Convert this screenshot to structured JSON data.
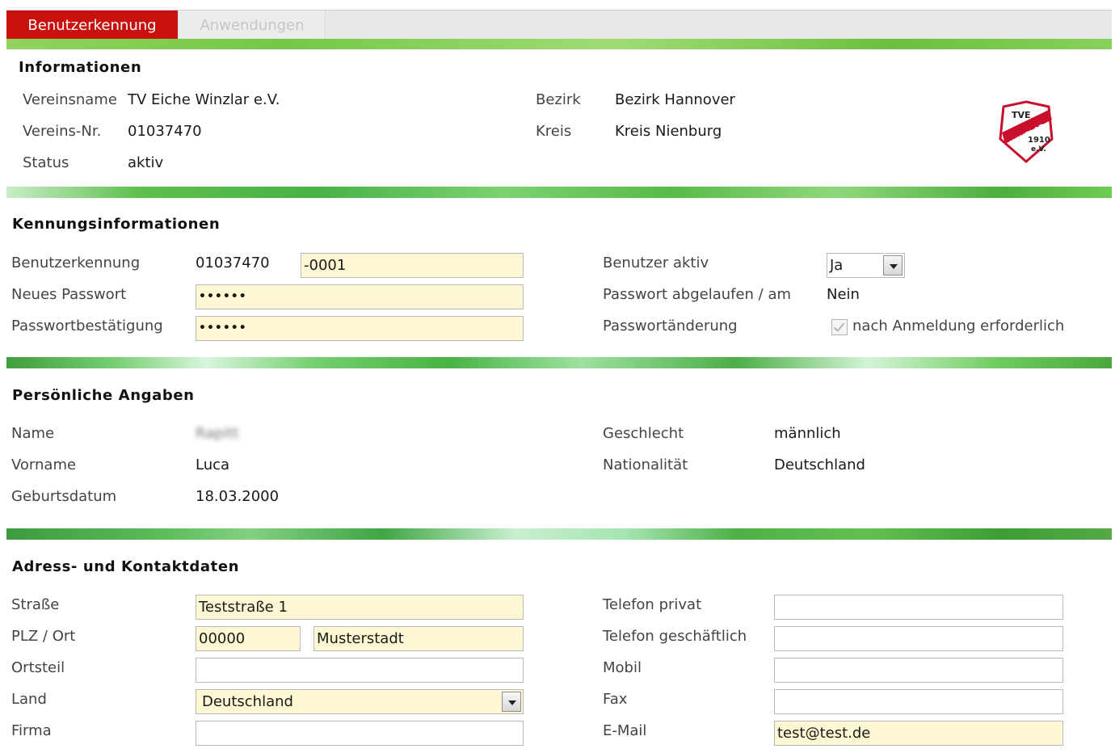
{
  "tabs": [
    {
      "label": "Benutzerkennung",
      "active": true
    },
    {
      "label": "Anwendungen",
      "active": false
    }
  ],
  "informationen": {
    "heading": "Informationen",
    "vereinsname": {
      "label": "Vereinsname",
      "value": "TV Eiche Winzlar e.V."
    },
    "vereinsnr": {
      "label": "Vereins-Nr.",
      "value": "01037470"
    },
    "status": {
      "label": "Status",
      "value": "aktiv"
    },
    "bezirk": {
      "label": "Bezirk",
      "value": "Bezirk Hannover"
    },
    "kreis": {
      "label": "Kreis",
      "value": "Kreis Nienburg"
    },
    "logo": {
      "icon": "club-logo-icon",
      "line1": "TVE",
      "line2": "WINZLAR",
      "line3": "1910",
      "line4": "e.V.",
      "color": "#c8102e"
    }
  },
  "kennung": {
    "heading": "Kennungsinformationen",
    "benutzerkennung": {
      "label": "Benutzerkennung",
      "prefix": "01037470",
      "suffix": "-0001"
    },
    "passwort": {
      "label": "Neues Passwort",
      "value": "••••••"
    },
    "bestaetigung": {
      "label": "Passwortbestätigung",
      "value": "••••••"
    },
    "aktiv": {
      "label": "Benutzer aktiv",
      "value": "Ja"
    },
    "abgelaufen": {
      "label": "Passwort abgelaufen / am",
      "value": "Nein"
    },
    "aenderung": {
      "label": "Passwortänderung",
      "checkbox_label": "nach Anmeldung erforderlich",
      "checked": true
    }
  },
  "persoenlich": {
    "heading": "Persönliche Angaben",
    "name": {
      "label": "Name",
      "value": "Rapitt"
    },
    "vorname": {
      "label": "Vorname",
      "value": "Luca"
    },
    "geburtsdatum": {
      "label": "Geburtsdatum",
      "value": "18.03.2000"
    },
    "geschlecht": {
      "label": "Geschlecht",
      "value": "männlich"
    },
    "nationalitaet": {
      "label": "Nationalität",
      "value": "Deutschland"
    }
  },
  "adresse": {
    "heading": "Adress- und Kontaktdaten",
    "strasse": {
      "label": "Straße",
      "value": "Teststraße 1"
    },
    "plzort": {
      "label": "PLZ / Ort",
      "plz": "00000",
      "ort": "Musterstadt"
    },
    "ortsteil": {
      "label": "Ortsteil",
      "value": ""
    },
    "land": {
      "label": "Land",
      "value": "Deutschland"
    },
    "firma": {
      "label": "Firma",
      "value": ""
    },
    "tel_privat": {
      "label": "Telefon privat",
      "value": ""
    },
    "tel_geschaeft": {
      "label": "Telefon geschäftlich",
      "value": ""
    },
    "mobil": {
      "label": "Mobil",
      "value": ""
    },
    "fax": {
      "label": "Fax",
      "value": ""
    },
    "email": {
      "label": "E-Mail",
      "value": "test@test.de"
    }
  },
  "colors": {
    "tab_active": "#c8100f",
    "accent_green": "#5ebd4a",
    "required_field": "#fdf8d3"
  }
}
